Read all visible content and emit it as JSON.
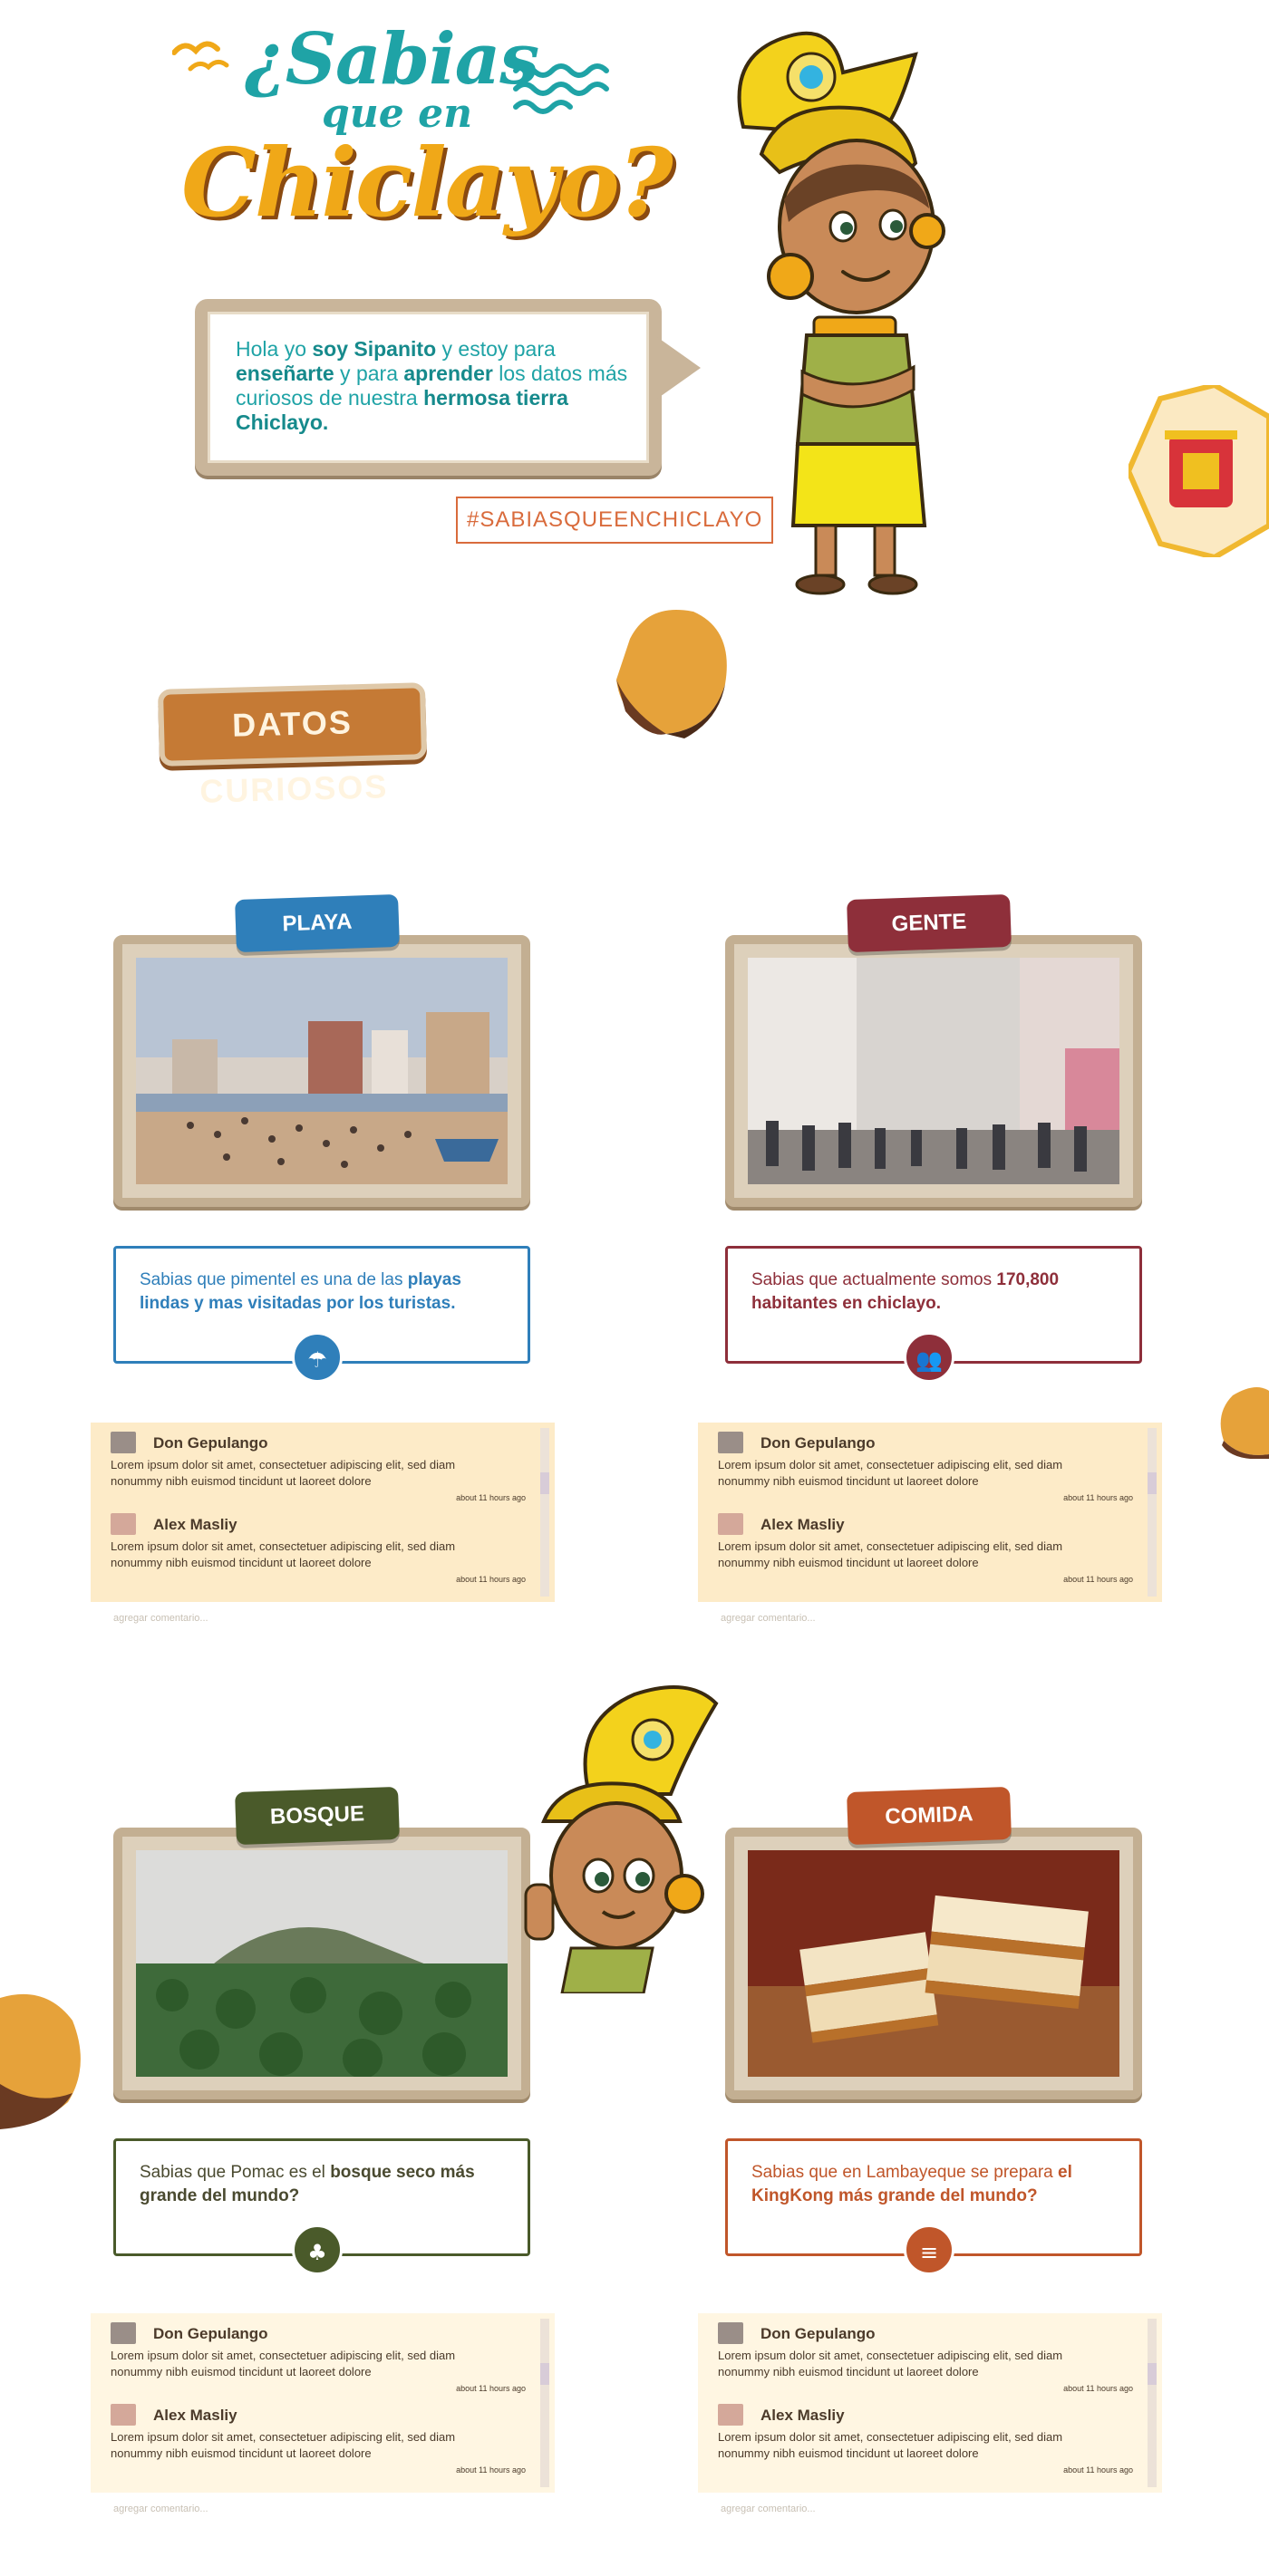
{
  "header": {
    "title_line1": "¿Sabias",
    "title_line2": "que   en",
    "title_line3": "Chiclayo?",
    "intro_parts": [
      {
        "text": "Hola yo ",
        "bold": false
      },
      {
        "text": "soy Sipanito",
        "bold": true
      },
      {
        "text": " y estoy para ",
        "bold": false
      },
      {
        "text": "enseñarte",
        "bold": true
      },
      {
        "text": " y para ",
        "bold": false
      },
      {
        "text": "aprender",
        "bold": true
      },
      {
        "text": " los datos más curiosos de nuestra  ",
        "bold": false
      },
      {
        "text": "hermosa tierra Chiclayo.",
        "bold": true
      }
    ],
    "hashtag": "#SABIASQUEENCHICLAYO",
    "datos_button": "DATOS CURIOSOS"
  },
  "colors": {
    "teal": "#1fa3a6",
    "orange": "#f0a818",
    "playa": "#2f7fba",
    "gente": "#8e2f3a",
    "bosque": "#4a5a2a",
    "comida": "#c0562a",
    "comment_bg_top": "#fdebc8",
    "comment_bg_bottom": "#fff6e2"
  },
  "cards": [
    {
      "tag": "PLAYA",
      "icon": "beach-umbrella-icon",
      "fact": [
        {
          "text": "Sabias que pimentel es una de las ",
          "bold": false
        },
        {
          "text": "playas lindas y mas visitadas por los turistas.",
          "bold": true
        }
      ]
    },
    {
      "tag": "GENTE",
      "icon": "people-icon",
      "fact": [
        {
          "text": "Sabias que actualmente somos ",
          "bold": false
        },
        {
          "text": "170,800 habitantes en chiclayo.",
          "bold": true
        }
      ]
    },
    {
      "tag": "BOSQUE",
      "icon": "tree-icon",
      "fact": [
        {
          "text": "Sabias que Pomac es el ",
          "bold": false
        },
        {
          "text": "bosque seco más grande del mundo?",
          "bold": true
        }
      ]
    },
    {
      "tag": "COMIDA",
      "icon": "food-icon",
      "fact": [
        {
          "text": "Sabias que en Lambayeque se prepara ",
          "bold": false
        },
        {
          "text": "el KingKong más grande del mundo?",
          "bold": true
        }
      ]
    }
  ],
  "comments": [
    {
      "name": "Don Gepulango",
      "text": "Lorem ipsum dolor sit amet, consectetuer adipiscing elit, sed diam nonummy nibh euismod tincidunt ut laoreet dolore",
      "time": "about 11 hours ago"
    },
    {
      "name": "Alex Masliy",
      "text": "Lorem ipsum dolor sit amet, consectetuer adipiscing elit, sed diam nonummy nibh euismod tincidunt ut laoreet dolore",
      "time": "about 11 hours ago"
    }
  ],
  "add_comment_placeholder": "agregar comentario..."
}
